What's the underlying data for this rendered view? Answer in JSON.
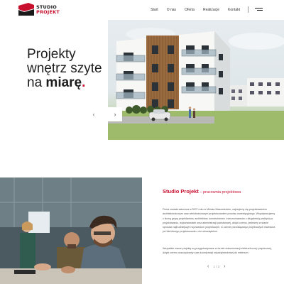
{
  "brand": {
    "line1": "STUDIO",
    "line2": "PROJEKT",
    "red": "#c8102e",
    "dark": "#1a1a1a"
  },
  "nav": {
    "items": [
      "Start",
      "O nas",
      "Oferta",
      "Realizacje",
      "Kontakt"
    ]
  },
  "hero": {
    "line1": "Projekty",
    "line2": "wnętrz szyte",
    "line3_prefix": "na ",
    "line3_strong": "miarę",
    "line3_dot": ".",
    "prev_icon": "chevron-left-icon",
    "next_icon": "chevron-right-icon"
  },
  "about": {
    "title": "Studio Projekt",
    "subtitle": " – pracownia projektowa",
    "p1": "Firma została założona w 2007 roku w Mińsku Mazowieckim, zajmujemy się projektowaniem architektonicznym oraz wielobranżowym projektowaniem procesu inwestycyjnego. Współpracujemy z liczną grupą projektantów, architektów, konstruktorów i rzeczoznawców z długoletnią praktyką w projektowaniu, wykonawstwie oraz administracji państwowej, dzięki czemu, jesteśmy w stanie sprostać najtrudniejszym wyzwaniom projektowym, w ocenie przedsięwzięć projektowych inwestora już dla którego projektowania z nie obowiązkiem.",
    "p2": "Wszystkie nasze projekty są przygotowywane w formie dokumentacji elektronicznej i papierowej, dzięki czemu oszczędzamy czas koordynacji międzybranżowej do minimum.",
    "pager": "1 / 3"
  }
}
